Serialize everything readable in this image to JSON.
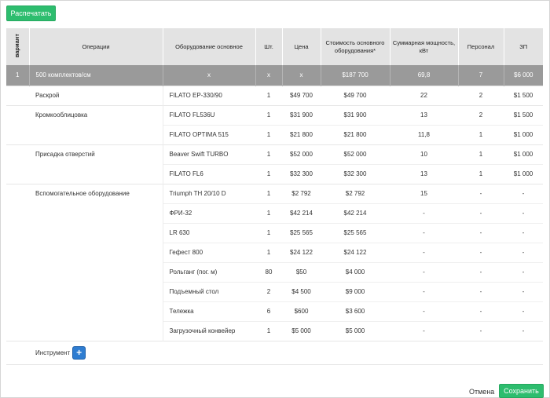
{
  "toolbar": {
    "print_label": "Распечатать"
  },
  "table": {
    "headers": {
      "variant": "вариант",
      "operations": "Операции",
      "equipment": "Оборудование основное",
      "qty": "Шт.",
      "price": "Цена",
      "cost": "Стоимость основного оборудования*",
      "power": "Суммарная мощность, кВт",
      "staff": "Персонал",
      "salary": "ЗП"
    },
    "group": {
      "variant": "1",
      "label": "500 комплектов/см",
      "equipment": "x",
      "qty": "x",
      "price": "x",
      "cost": "$187 700",
      "power": "69,8",
      "staff": "7",
      "salary": "$6 000"
    },
    "rows": [
      {
        "op": "Раскрой",
        "eq": "FILATO EP-330/90",
        "qty": "1",
        "price": "$49 700",
        "cost": "$49 700",
        "power": "22",
        "staff": "2",
        "salary": "$1 500"
      },
      {
        "op": "Кромкооблицовка",
        "eq": "FILATO FL536U",
        "qty": "1",
        "price": "$31 900",
        "cost": "$31 900",
        "power": "13",
        "staff": "2",
        "salary": "$1 500"
      },
      {
        "op": "",
        "eq": "FILATO OPTIMA 515",
        "qty": "1",
        "price": "$21 800",
        "cost": "$21 800",
        "power": "11,8",
        "staff": "1",
        "salary": "$1 000"
      },
      {
        "op": "Присадка отверстий",
        "eq": "Beaver Swift TURBO",
        "qty": "1",
        "price": "$52 000",
        "cost": "$52 000",
        "power": "10",
        "staff": "1",
        "salary": "$1 000"
      },
      {
        "op": "",
        "eq": "FILATO FL6",
        "qty": "1",
        "price": "$32 300",
        "cost": "$32 300",
        "power": "13",
        "staff": "1",
        "salary": "$1 000"
      },
      {
        "op": "Вспомогательное оборудование",
        "eq": "Triumph TH 20/10 D",
        "qty": "1",
        "price": "$2 792",
        "cost": "$2 792",
        "power": "15",
        "staff": "-",
        "salary": "-"
      },
      {
        "op": "",
        "eq": "ФРИ-32",
        "qty": "1",
        "price": "$42 214",
        "cost": "$42 214",
        "power": "-",
        "staff": "-",
        "salary": "-"
      },
      {
        "op": "",
        "eq": "LR 630",
        "qty": "1",
        "price": "$25 565",
        "cost": "$25 565",
        "power": "-",
        "staff": "-",
        "salary": "-"
      },
      {
        "op": "",
        "eq": "Гефест 800",
        "qty": "1",
        "price": "$24 122",
        "cost": "$24 122",
        "power": "-",
        "staff": "-",
        "salary": "-"
      },
      {
        "op": "",
        "eq": "Рольганг (пог. м)",
        "qty": "80",
        "price": "$50",
        "cost": "$4 000",
        "power": "-",
        "staff": "-",
        "salary": "-"
      },
      {
        "op": "",
        "eq": "Подъемный стол",
        "qty": "2",
        "price": "$4 500",
        "cost": "$9 000",
        "power": "-",
        "staff": "-",
        "salary": "-"
      },
      {
        "op": "",
        "eq": "Тележка",
        "qty": "6",
        "price": "$600",
        "cost": "$3 600",
        "power": "-",
        "staff": "-",
        "salary": "-"
      },
      {
        "op": "",
        "eq": "Загрузочный конвейер",
        "qty": "1",
        "price": "$5 000",
        "cost": "$5 000",
        "power": "-",
        "staff": "-",
        "salary": "-"
      }
    ],
    "instrument_label": "Инструмент",
    "add_symbol": "+"
  },
  "footer": {
    "cancel_label": "Отмена",
    "save_label": "Сохранить"
  },
  "colors": {
    "accent_green": "#2dbd6e",
    "accent_blue": "#2f7dd1",
    "group_row": "#9a9a9a",
    "header_bg": "#e3e3e3"
  }
}
